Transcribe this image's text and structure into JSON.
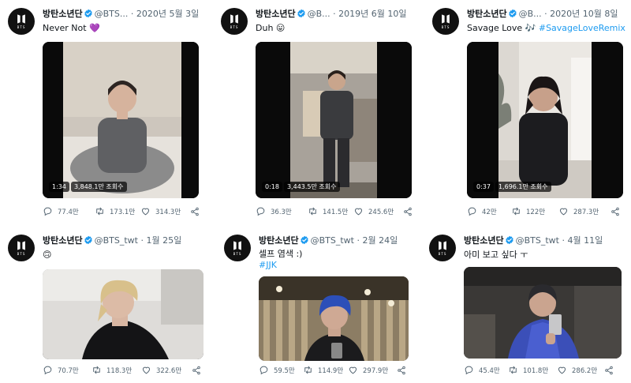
{
  "tweets": [
    {
      "name": "방탄소년단",
      "handle": "@BTS...",
      "date": "2020년 5월 3일",
      "text": "Never Not 💜",
      "link": "",
      "video": {
        "duration": "1:34",
        "views": "3,848.1만 조회수"
      },
      "replies": "77.4만",
      "retweets": "173.1만",
      "likes": "314.3만"
    },
    {
      "name": "방탄소년단",
      "handle": "@B...",
      "date": "2019년 6월 10일",
      "text": "Duh 😛",
      "link": "",
      "video": {
        "duration": "0:18",
        "views": "3,443.5만 조회수"
      },
      "replies": "36.3만",
      "retweets": "141.5만",
      "likes": "245.6만"
    },
    {
      "name": "방탄소년단",
      "handle": "@B...",
      "date": "2020년 10월 8일",
      "text": "Savage Love 🎶",
      "link": "#SavageLoveRemix",
      "video": {
        "duration": "0:37",
        "views": "1,696.1만 조회수"
      },
      "replies": "42만",
      "retweets": "122만",
      "likes": "287.3만"
    },
    {
      "name": "방탄소년단",
      "handle": "@BTS_twt",
      "date": "1월 25일",
      "text": "🙃",
      "link": "",
      "replies": "70.7만",
      "retweets": "118.3만",
      "likes": "322.6만"
    },
    {
      "name": "방탄소년단",
      "handle": "@BTS_twt",
      "date": "2월 24일",
      "text": "셀프 염색 :)",
      "link": "#JJK",
      "replies": "59.5만",
      "retweets": "114.9만",
      "likes": "297.9만"
    },
    {
      "name": "방탄소년단",
      "handle": "@BTS_twt",
      "date": "4월 11일",
      "text": "아미 보고 싶다 ㅜ",
      "link": "",
      "replies": "45.4만",
      "retweets": "101.8만",
      "likes": "286.2만"
    }
  ],
  "dot": "·",
  "avatar_text": "BTS",
  "icons": [
    "bts-logo-icon",
    "verified-icon",
    "reply-icon",
    "retweet-icon",
    "like-icon",
    "share-icon"
  ],
  "colors": {
    "verified": "#1d9bf0",
    "link": "#1d9bf0",
    "meta": "#536471",
    "text": "#0f1419"
  }
}
